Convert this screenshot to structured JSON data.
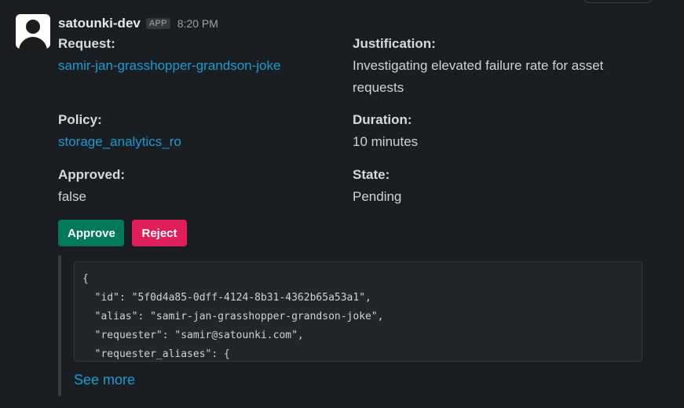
{
  "message": {
    "sender": "satounki-dev",
    "badge": "APP",
    "time": "8:20 PM"
  },
  "fields": {
    "request": {
      "label": "Request:",
      "value": "samir-jan-grasshopper-grandson-joke"
    },
    "justification": {
      "label": "Justification:",
      "value": "Investigating elevated failure rate for asset requests"
    },
    "policy": {
      "label": "Policy:",
      "value": "storage_analytics_ro"
    },
    "duration": {
      "label": "Duration:",
      "value": "10 minutes"
    },
    "approved": {
      "label": "Approved:",
      "value": "false"
    },
    "state": {
      "label": "State:",
      "value": "Pending"
    }
  },
  "buttons": {
    "approve": "Approve",
    "reject": "Reject"
  },
  "code": {
    "lines": [
      "{",
      "  \"id\": \"5f0d4a85-0dff-4124-8b31-4362b65a53a1\",",
      "  \"alias\": \"samir-jan-grasshopper-grandson-joke\",",
      "  \"requester\": \"samir@satounki.com\",",
      "  \"requester_aliases\": {"
    ]
  },
  "see_more": "See more",
  "colors": {
    "background": "#1a1d21",
    "link": "#1d9bd1",
    "approve": "#007a5a",
    "reject": "#e01e5a"
  },
  "icons": {
    "avatar": "user-silhouette-icon"
  }
}
